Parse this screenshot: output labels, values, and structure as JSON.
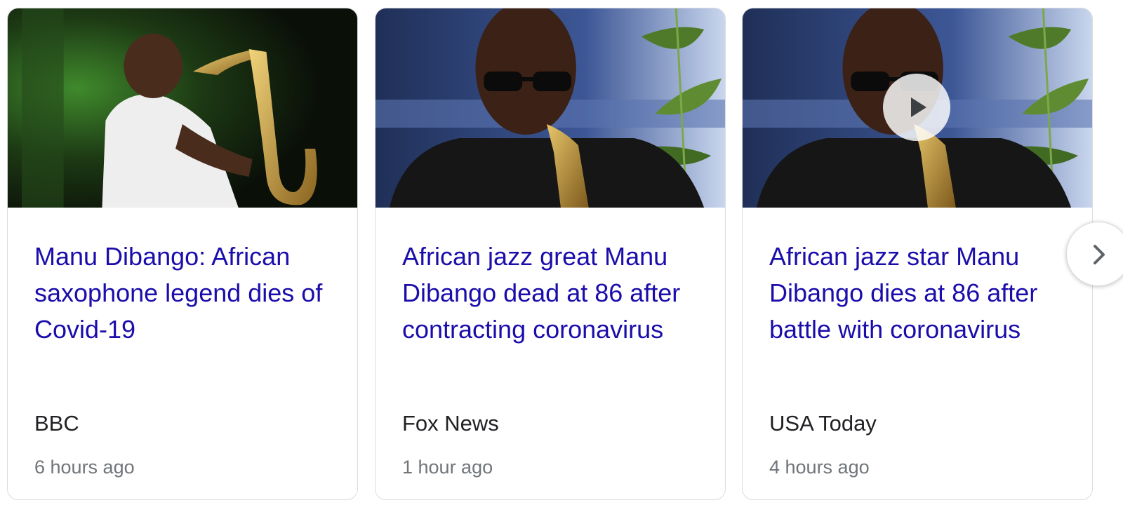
{
  "news_cards": [
    {
      "headline": "Manu Dibango: African saxophone legend dies of Covid-19",
      "source": "BBC",
      "time": "6 hours ago",
      "has_video": false
    },
    {
      "headline": "African jazz great Manu Dibango dead at 86 after contracting coronavirus",
      "source": "Fox News",
      "time": "1 hour ago",
      "has_video": false
    },
    {
      "headline": "African jazz star Manu Dibango dies at 86 after battle with coronavirus",
      "source": "USA Today",
      "time": "4 hours ago",
      "has_video": true
    }
  ],
  "icons": {
    "play": "play-icon",
    "next": "chevron-right-icon"
  },
  "colors": {
    "headline_link": "#1a0dab",
    "source_text": "#202124",
    "time_text": "#70757a",
    "card_border": "#dadce0"
  }
}
